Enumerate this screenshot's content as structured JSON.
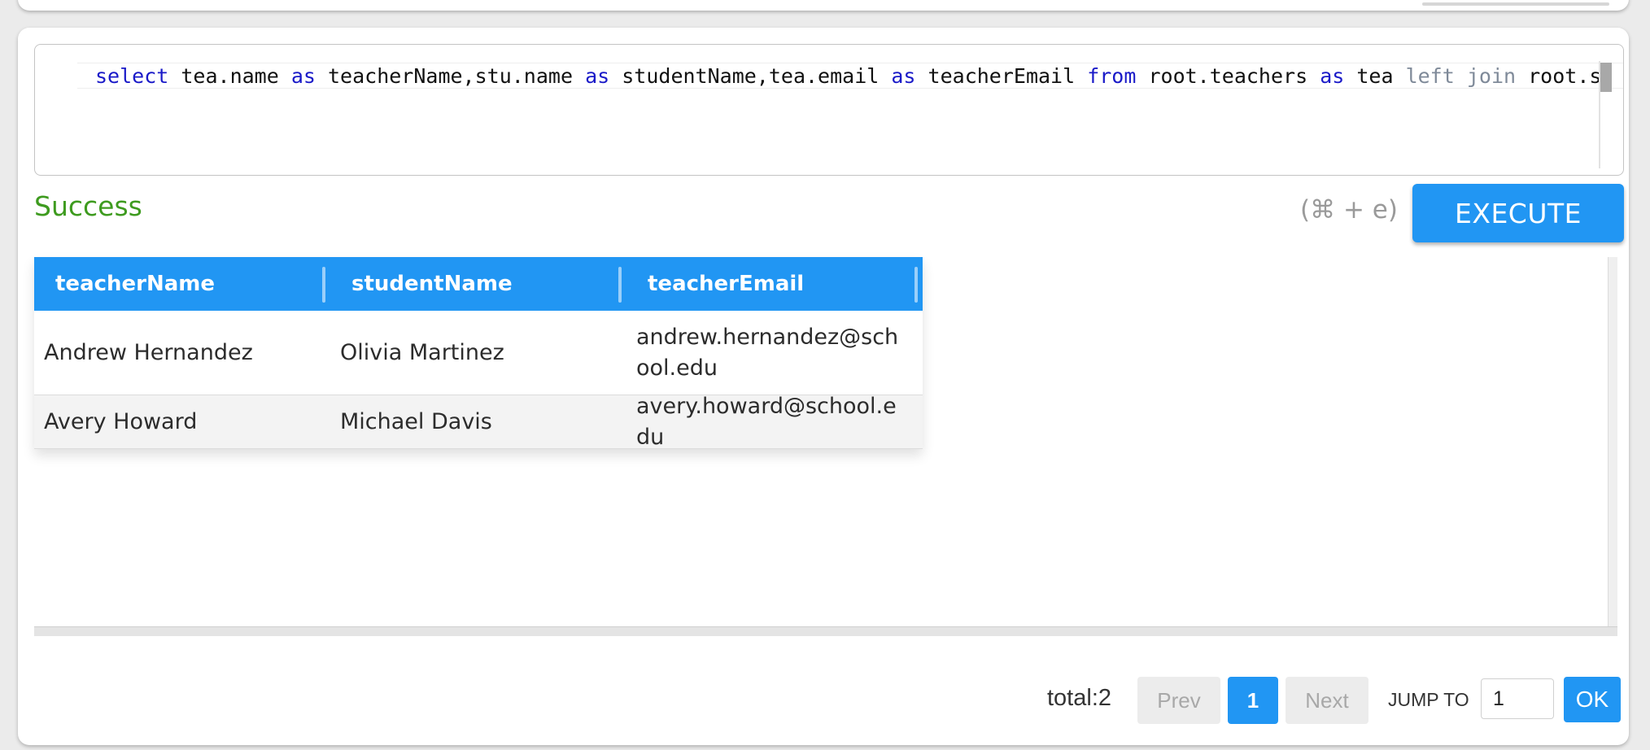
{
  "editor": {
    "tokens": [
      {
        "t": "select",
        "c": "kw"
      },
      {
        "t": " tea.name ",
        "c": ""
      },
      {
        "t": "as",
        "c": "kw"
      },
      {
        "t": " teacherName,stu.name ",
        "c": ""
      },
      {
        "t": "as",
        "c": "kw"
      },
      {
        "t": " studentName,tea.email ",
        "c": ""
      },
      {
        "t": "as",
        "c": "kw"
      },
      {
        "t": " teacherEmail ",
        "c": ""
      },
      {
        "t": "from",
        "c": "kw"
      },
      {
        "t": " root.teachers ",
        "c": ""
      },
      {
        "t": "as",
        "c": "kw"
      },
      {
        "t": " tea ",
        "c": ""
      },
      {
        "t": "left",
        "c": "kw2"
      },
      {
        "t": " ",
        "c": ""
      },
      {
        "t": "join",
        "c": "kw2"
      },
      {
        "t": " root.st",
        "c": ""
      }
    ]
  },
  "status": "Success",
  "shortcut": "(⌘ + e)",
  "execute_label": "EXECUTE",
  "table": {
    "columns": [
      "teacherName",
      "studentName",
      "teacherEmail"
    ],
    "rows": [
      [
        "Andrew Hernandez",
        "Olivia Martinez",
        "andrew.hernandez@school.edu"
      ],
      [
        "Avery Howard",
        "Michael Davis",
        "avery.howard@school.edu"
      ]
    ]
  },
  "pagination": {
    "total": "total:2",
    "prev": "Prev",
    "current": "1",
    "next": "Next",
    "jump_label": "JUMP TO",
    "jump_value": "1",
    "ok": "OK"
  }
}
